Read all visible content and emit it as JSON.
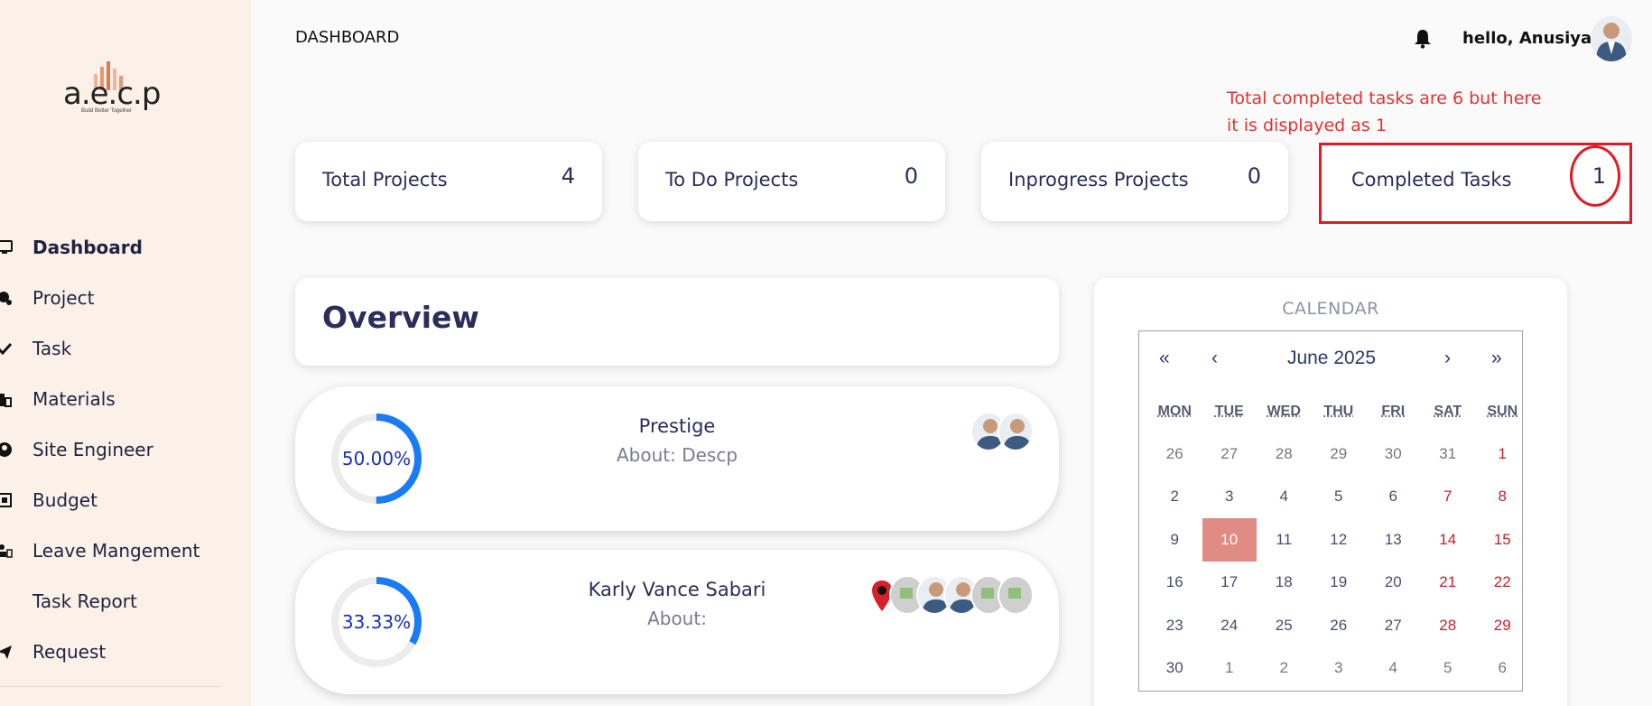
{
  "header": {
    "title": "DASHBOARD",
    "greeting": "hello, Anusiya!"
  },
  "logo": {
    "text": "a.e.c.p",
    "tagline": "Build Better Together"
  },
  "sidebar": {
    "items": [
      {
        "label": "Dashboard",
        "icon": "monitor-icon",
        "active": true
      },
      {
        "label": "Project",
        "icon": "project-icon"
      },
      {
        "label": "Task",
        "icon": "check-icon"
      },
      {
        "label": "Materials",
        "icon": "building-icon"
      },
      {
        "label": "Site Engineer",
        "icon": "user-circle-icon"
      },
      {
        "label": "Budget",
        "icon": "budget-icon"
      },
      {
        "label": "Leave Mangement",
        "icon": "user-card-icon"
      },
      {
        "label": "Task Report",
        "icon": ""
      },
      {
        "label": "Request",
        "icon": "send-icon"
      }
    ]
  },
  "annotation": {
    "text": "Total completed tasks are 6 but here it is displayed as 1",
    "color": "#e4332e"
  },
  "stats": [
    {
      "label": "Total Projects",
      "value": "4"
    },
    {
      "label": "To Do Projects",
      "value": "0"
    },
    {
      "label": "Inprogress Projects",
      "value": "0"
    },
    {
      "label": "Completed Tasks",
      "value": "1"
    }
  ],
  "overview": {
    "title": "Overview",
    "projects": [
      {
        "name": "Prestige",
        "about": "About: Descp",
        "progress_label": "50.00%",
        "progress": 0.5,
        "avatars": 2
      },
      {
        "name": "Karly Vance Sabari",
        "about": "About:",
        "progress_label": "33.33%",
        "progress": 0.3333,
        "avatars": 6
      }
    ]
  },
  "calendar": {
    "heading": "CALENDAR",
    "month": "June 2025",
    "nav": {
      "prev_year": "«",
      "prev": "‹",
      "next": "›",
      "next_year": "»"
    },
    "weekdays": [
      "MON",
      "TUE",
      "WED",
      "THU",
      "FRI",
      "SAT",
      "SUN"
    ],
    "days": [
      "26",
      "27",
      "28",
      "29",
      "30",
      "31",
      "1",
      "2",
      "3",
      "4",
      "5",
      "6",
      "7",
      "8",
      "9",
      "10",
      "11",
      "12",
      "13",
      "14",
      "15",
      "16",
      "17",
      "18",
      "19",
      "20",
      "21",
      "22",
      "23",
      "24",
      "25",
      "26",
      "27",
      "28",
      "29",
      "30",
      "1",
      "2",
      "3",
      "4",
      "5",
      "6"
    ],
    "today": "10",
    "accent": "#e08b84",
    "weekend_color": "#c8202b"
  }
}
